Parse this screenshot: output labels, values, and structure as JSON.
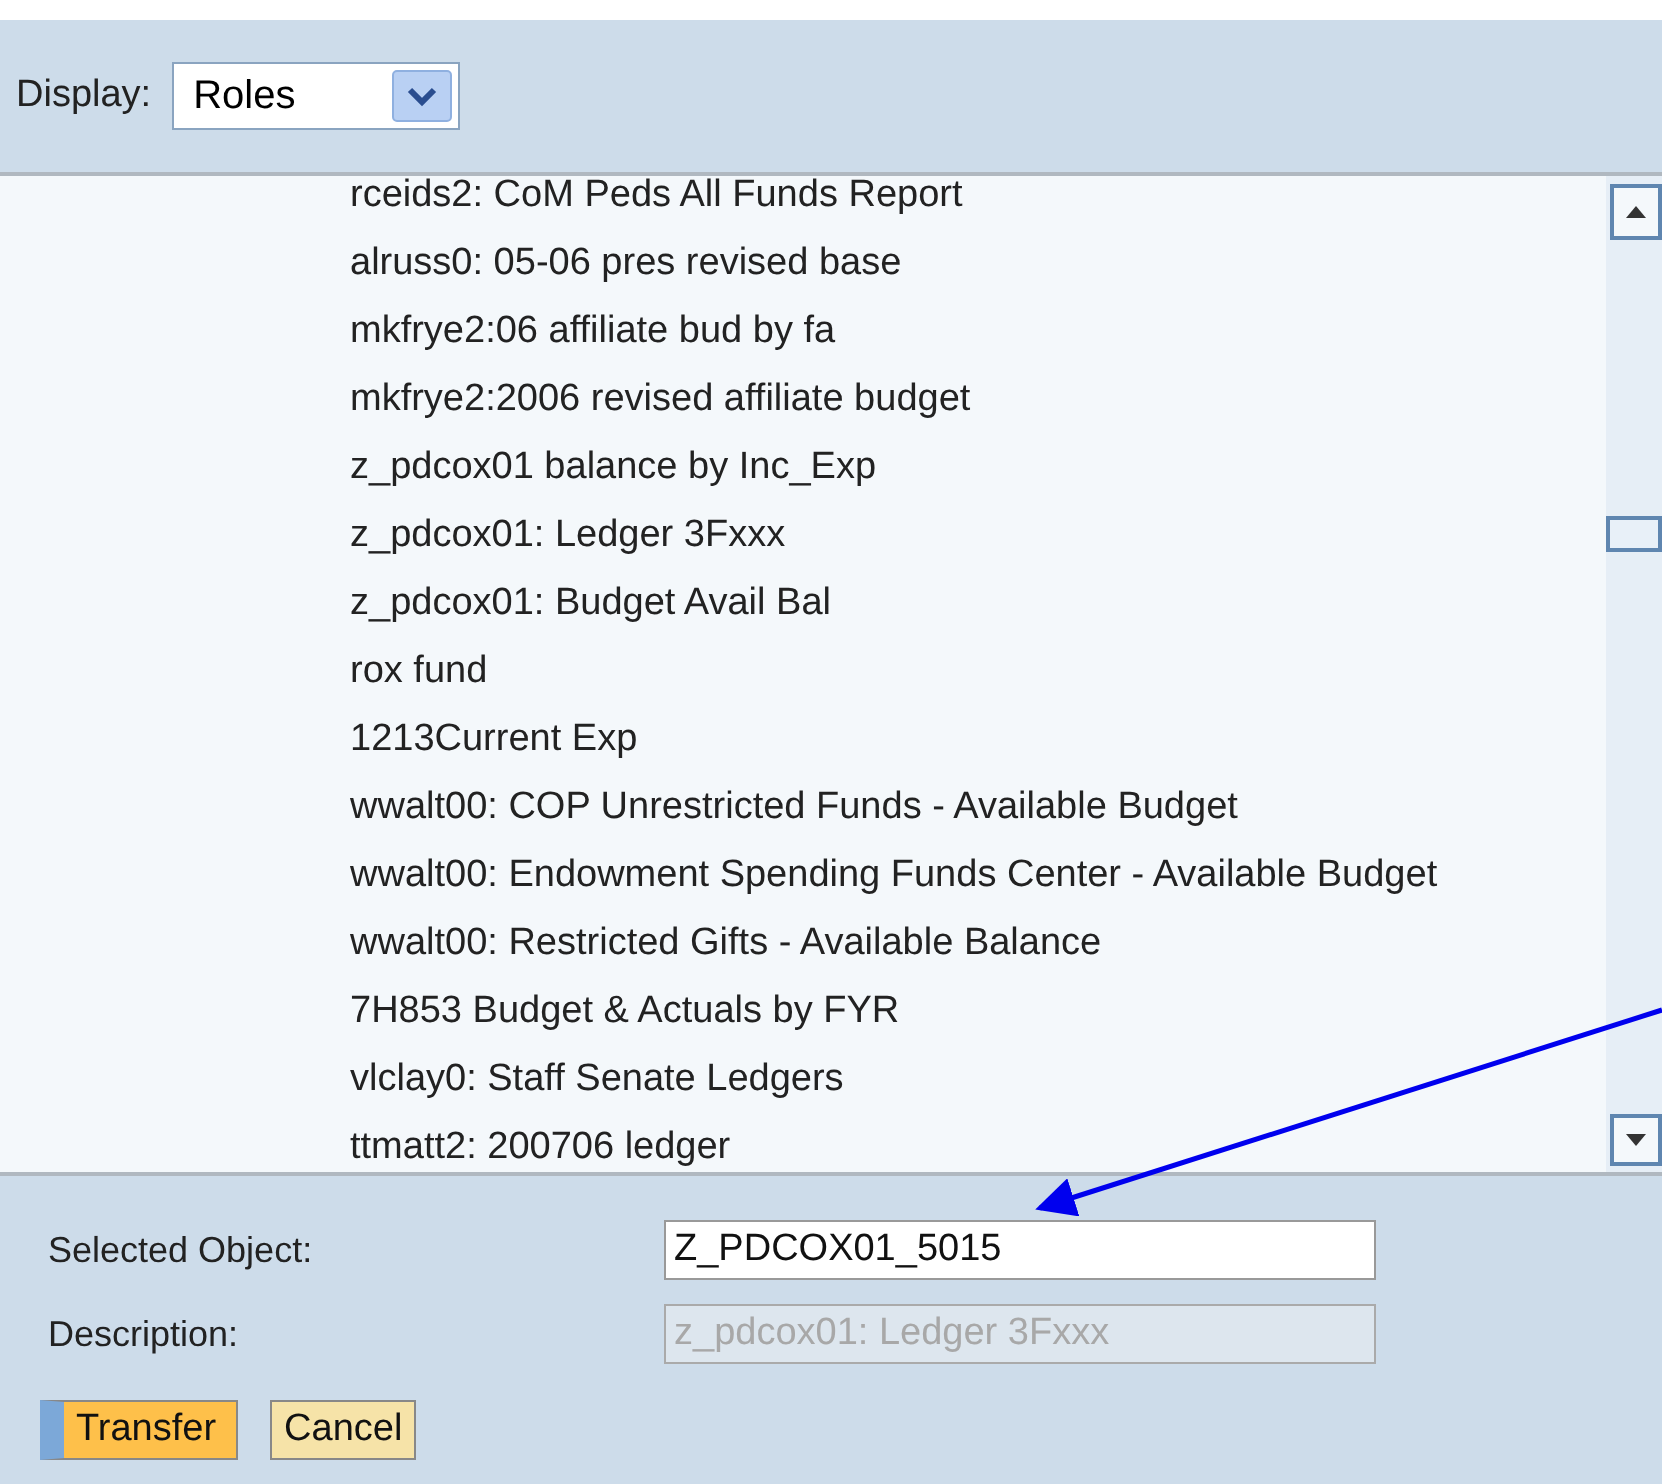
{
  "display": {
    "label": "Display:",
    "value": "Roles"
  },
  "items": [
    {
      "text": "rceids2: CoM Peds All Funds Report"
    },
    {
      "text": "alruss0: 05-06 pres revised base"
    },
    {
      "text": "mkfrye2:06 affiliate bud by fa"
    },
    {
      "text": "mkfrye2:2006 revised affiliate budget"
    },
    {
      "text": "z_pdcox01 balance by Inc_Exp"
    },
    {
      "text": "z_pdcox01: Ledger 3Fxxx"
    },
    {
      "text": "z_pdcox01: Budget Avail Bal"
    },
    {
      "text": "rox fund"
    },
    {
      "text": "1213Current Exp"
    },
    {
      "text": "wwalt00: COP Unrestricted Funds - Available Budget"
    },
    {
      "text": "wwalt00: Endowment Spending Funds Center - Available Budget"
    },
    {
      "text": "wwalt00: Restricted Gifts - Available Balance"
    },
    {
      "text": "7H853 Budget & Actuals by FYR"
    },
    {
      "text": "vlclay0: Staff Senate Ledgers"
    },
    {
      "text": "ttmatt2: 200706 ledger"
    }
  ],
  "fields": [
    {
      "label": "Selected Object:",
      "value": "Z_PDCOX01_5015",
      "disabled": false
    },
    {
      "label": "Description:",
      "value": "z_pdcox01: Ledger 3Fxxx",
      "disabled": true
    }
  ],
  "buttons": [
    {
      "label": "Transfer",
      "primary": true
    },
    {
      "label": "Cancel",
      "primary": false
    }
  ]
}
